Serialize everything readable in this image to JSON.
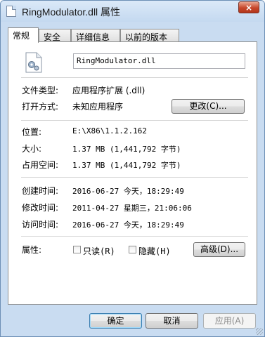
{
  "window": {
    "title": "RingModulator.dll 属性",
    "close": "×"
  },
  "tabs": [
    "常规",
    "安全",
    "详细信息",
    "以前的版本"
  ],
  "general": {
    "file_name": "RingModulator.dll",
    "file_type_label": "文件类型:",
    "file_type_value": "应用程序扩展 (.dll)",
    "opens_with_label": "打开方式:",
    "opens_with_value": "未知应用程序",
    "change_button": "更改(C)...",
    "location_label": "位置:",
    "location_value": "E:\\X86\\1.1.2.162",
    "size_label": "大小:",
    "size_value": "1.37 MB (1,441,792 字节)",
    "size_on_disk_label": "占用空间:",
    "size_on_disk_value": "1.37 MB (1,441,792 字节)",
    "created_label": "创建时间:",
    "created_value": "2016-06-27 今天，18:29:49",
    "modified_label": "修改时间:",
    "modified_value": "2011-04-27 星期三，21:06:06",
    "accessed_label": "访问时间:",
    "accessed_value": "2016-06-27 今天，18:29:49",
    "attributes_label": "属性:",
    "readonly_label": "只读(R)",
    "hidden_label": "隐藏(H)",
    "advanced_button": "高级(D)..."
  },
  "footer": {
    "ok": "确定",
    "cancel": "取消",
    "apply": "应用(A)"
  }
}
